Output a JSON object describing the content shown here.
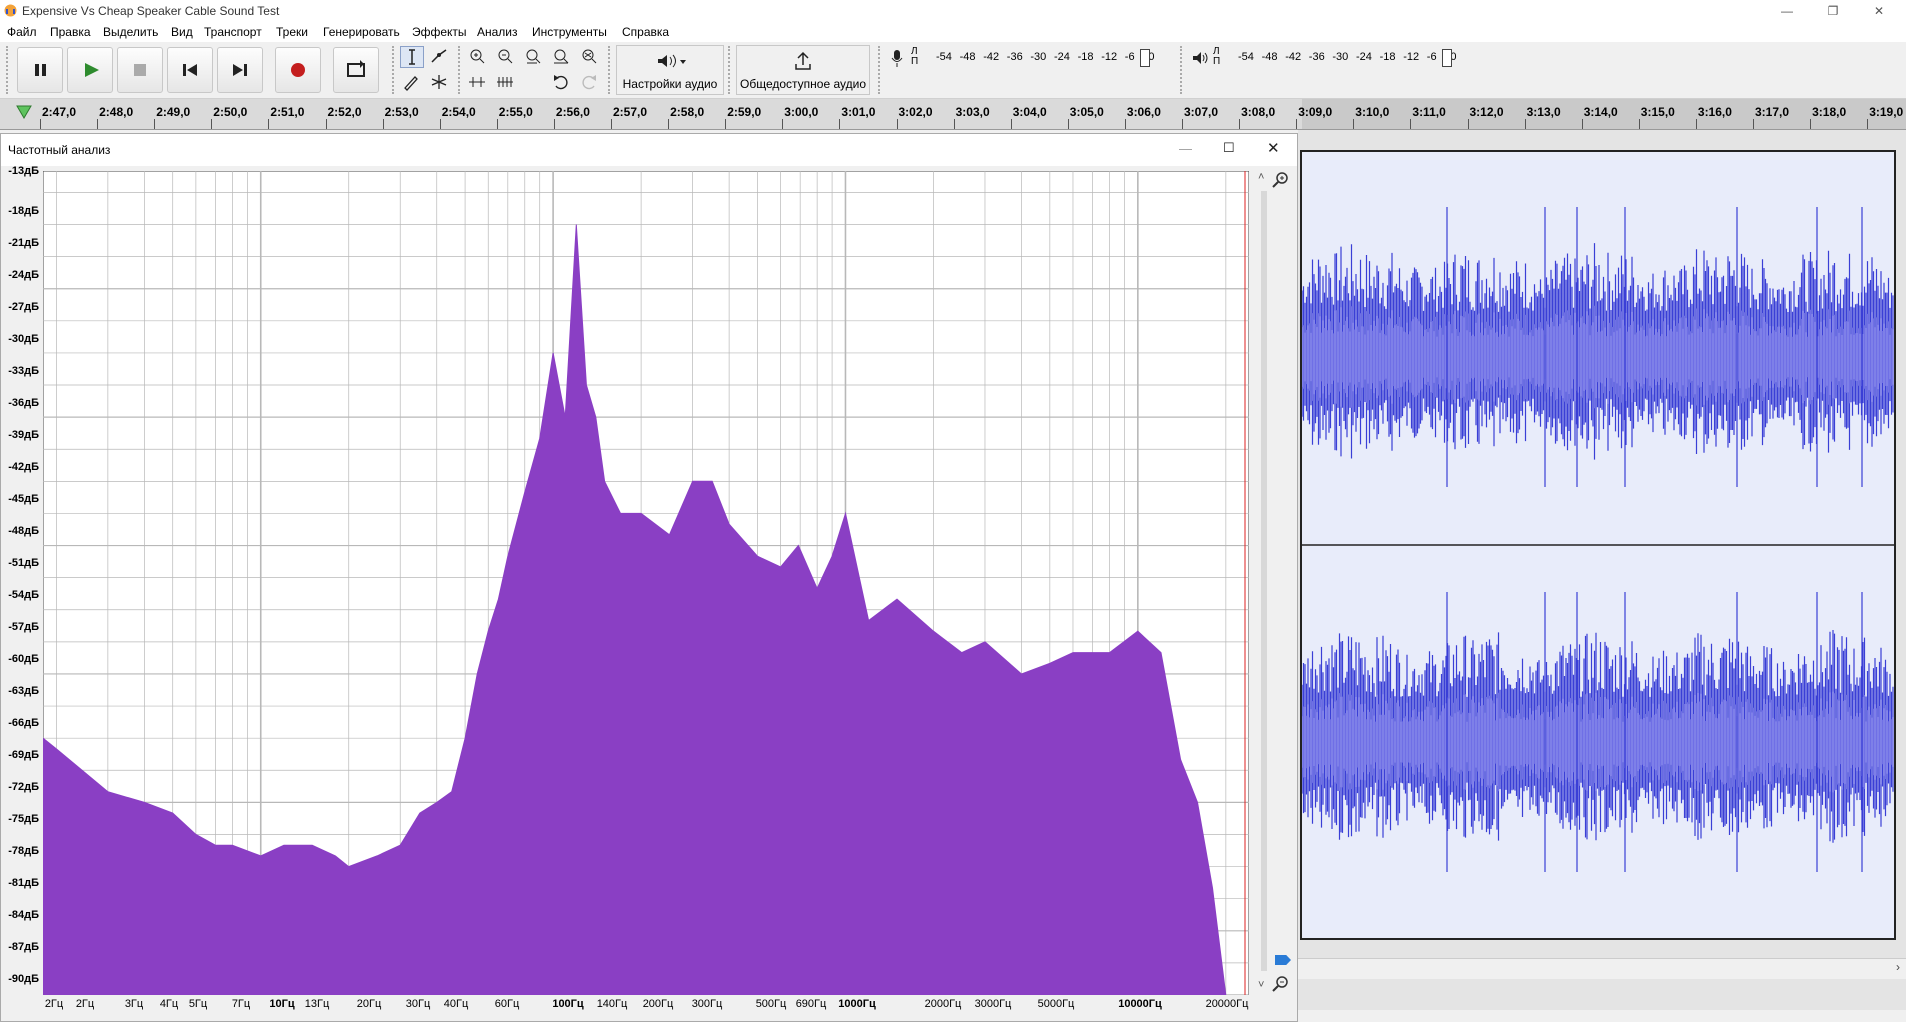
{
  "window": {
    "title": "Expensive Vs Cheap Speaker Cable Sound Test"
  },
  "menu": [
    "Файл",
    "Правка",
    "Выделить",
    "Вид",
    "Транспорт",
    "Треки",
    "Генерировать",
    "Эффекты",
    "Анализ",
    "Инструменты",
    "Справка"
  ],
  "toolbar": {
    "audio_settings_label": "Настройки аудио",
    "share_audio_label": "Общедоступное аудио",
    "record_meter_ticks": [
      "-54",
      "-48",
      "-42",
      "-36",
      "-30",
      "-24",
      "-18",
      "-12",
      "-6",
      "0"
    ],
    "play_meter_ticks": [
      "-54",
      "-48",
      "-42",
      "-36",
      "-30",
      "-24",
      "-18",
      "-12",
      "-6",
      "0"
    ],
    "meter_channels": [
      "Л",
      "П"
    ]
  },
  "timeline": {
    "ticks": [
      "2:47,0",
      "2:48,0",
      "2:49,0",
      "2:50,0",
      "2:51,0",
      "2:52,0",
      "2:53,0",
      "2:54,0",
      "2:55,0",
      "2:56,0",
      "2:57,0",
      "2:58,0",
      "2:59,0",
      "3:00,0",
      "3:01,0",
      "3:02,0",
      "3:03,0",
      "3:04,0",
      "3:05,0",
      "3:06,0",
      "3:07,0",
      "3:08,0",
      "3:09,0",
      "3:10,0",
      "3:11,0",
      "3:12,0",
      "3:13,0",
      "3:14,0",
      "3:15,0",
      "3:16,0",
      "3:17,0",
      "3:18,0",
      "3:19,0"
    ]
  },
  "freq_window": {
    "title": "Частотный анализ",
    "y_labels": [
      "-13дБ",
      "-18дБ",
      "-21дБ",
      "-24дБ",
      "-27дБ",
      "-30дБ",
      "-33дБ",
      "-36дБ",
      "-39дБ",
      "-42дБ",
      "-45дБ",
      "-48дБ",
      "-51дБ",
      "-54дБ",
      "-57дБ",
      "-60дБ",
      "-63дБ",
      "-66дБ",
      "-69дБ",
      "-72дБ",
      "-75дБ",
      "-78дБ",
      "-81дБ",
      "-84дБ",
      "-87дБ",
      "-90дБ"
    ],
    "x_labels": [
      "2Гц",
      "2Гц",
      "3Гц",
      "4Гц",
      "5Гц",
      "7Гц",
      "10Гц",
      "13Гц",
      "20Гц",
      "30Гц",
      "40Гц",
      "60Гц",
      "100Гц",
      "140Гц",
      "200Гц",
      "300Гц",
      "500Гц",
      "690Гц",
      "1000Гц",
      "2000Гц",
      "3000Гц",
      "5000Гц",
      "10000Гц",
      "20000Гц"
    ],
    "colors": {
      "spectrum": "#8a3fc4",
      "grid": "#b8b8b8",
      "waveform": "#3a3fd6",
      "waveform_rms": "#6f6fe6"
    }
  },
  "chart_data": {
    "type": "area",
    "xscale": "log",
    "xlim": [
      1.8,
      24000
    ],
    "ylim": [
      -90,
      -13
    ],
    "xlabel": "",
    "ylabel": "",
    "x": [
      1.8,
      2,
      3,
      4,
      5,
      6,
      7,
      8,
      10,
      12,
      15,
      18,
      20,
      25,
      30,
      35,
      40,
      45,
      50,
      55,
      60,
      65,
      70,
      80,
      90,
      100,
      110,
      120,
      130,
      140,
      150,
      170,
      200,
      250,
      300,
      350,
      400,
      500,
      600,
      690,
      800,
      900,
      1000,
      1200,
      1500,
      2000,
      2500,
      3000,
      4000,
      5000,
      6000,
      8000,
      10000,
      12000,
      14000,
      16000,
      18000,
      20000
    ],
    "y": [
      -66,
      -67,
      -71,
      -72,
      -73,
      -75,
      -76,
      -76,
      -77,
      -76,
      -76,
      -77,
      -78,
      -77,
      -76,
      -73,
      -72,
      -71,
      -66,
      -60,
      -56,
      -53,
      -49,
      -43,
      -38,
      -30,
      -36,
      -18,
      -33,
      -36,
      -42,
      -45,
      -45,
      -47,
      -42,
      -42,
      -46,
      -49,
      -50,
      -48,
      -52,
      -49,
      -45,
      -55,
      -53,
      -56,
      -58,
      -57,
      -60,
      -59,
      -58,
      -58,
      -56,
      -58,
      -68,
      -72,
      -80,
      -90
    ]
  }
}
